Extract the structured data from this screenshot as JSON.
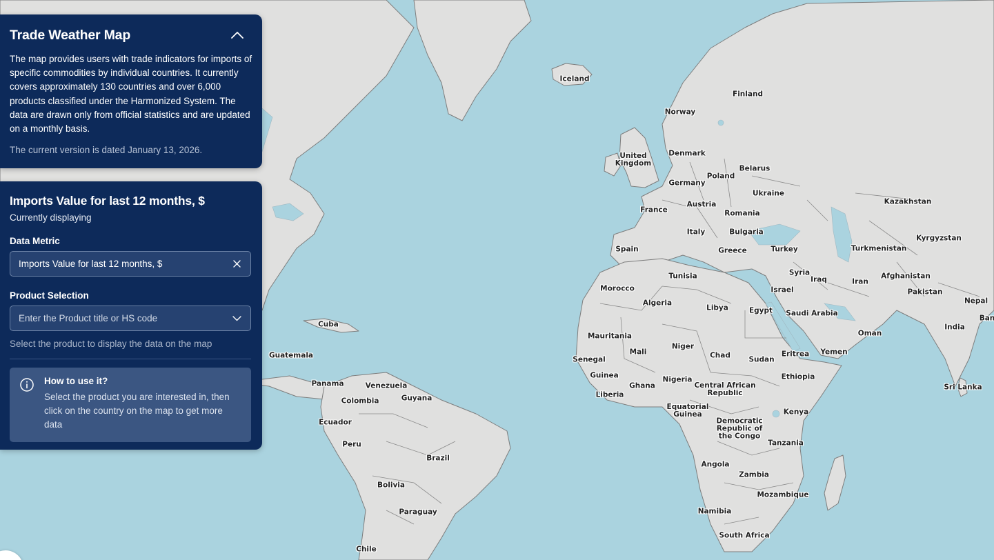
{
  "info_panel": {
    "title": "Trade Weather Map",
    "description": "The map provides users with trade indicators for imports of specific commodities by individual countries. It currently covers approximately 130 countries and over 6,000 products classified under the Harmonized System. The data are drawn only from official statistics and are updated on a monthly basis.",
    "version_text": "The current version is dated January 13, 2026.",
    "collapse_icon": "chevron-up-icon"
  },
  "controls_panel": {
    "title": "Imports Value for last 12 months, $",
    "subtitle": "Currently displaying",
    "metric_label": "Data Metric",
    "metric_value": "Imports Value for last 12 months, $",
    "product_label": "Product Selection",
    "product_placeholder": "Enter the Product title or HS code",
    "product_hint": "Select the product to display the data on the map",
    "howto_title": "How to use it?",
    "howto_body": "Select the product you are interested in, then click on the country on the map to get more data"
  },
  "map": {
    "colors": {
      "water": "#aad3df",
      "land": "#e0e0df",
      "panel": "#0d2a5a"
    },
    "countries": [
      [
        "Iceland"
      ],
      [
        "Finland"
      ],
      [
        "Norway"
      ],
      [
        "Denmark"
      ],
      [
        "United",
        "Kingdom"
      ],
      [
        "Belarus"
      ],
      [
        "Poland"
      ],
      [
        "Germany"
      ],
      [
        "Ukraine"
      ],
      [
        "Austria"
      ],
      [
        "France"
      ],
      [
        "Romania"
      ],
      [
        "Kazakhstan"
      ],
      [
        "Italy"
      ],
      [
        "Bulgaria"
      ],
      [
        "Kyrgyzstan"
      ],
      [
        "Spain"
      ],
      [
        "Turkey"
      ],
      [
        "Greece"
      ],
      [
        "Turkmenistan"
      ],
      [
        "Tunisia"
      ],
      [
        "Syria"
      ],
      [
        "Iraq"
      ],
      [
        "Afghanistan"
      ],
      [
        "Morocco"
      ],
      [
        "Israel"
      ],
      [
        "Iran"
      ],
      [
        "Pakistan"
      ],
      [
        "Nepal"
      ],
      [
        "Algeria"
      ],
      [
        "Libya"
      ],
      [
        "Egypt"
      ],
      [
        "Saudi Arabia"
      ],
      [
        "Ban"
      ],
      [
        "India"
      ],
      [
        "Cuba"
      ],
      [
        "Oman"
      ],
      [
        "Mauritania"
      ],
      [
        "Niger"
      ],
      [
        "Mali"
      ],
      [
        "Eritrea"
      ],
      [
        "Yemen"
      ],
      [
        "Chad"
      ],
      [
        "Guatemala"
      ],
      [
        "Senegal"
      ],
      [
        "Sudan"
      ],
      [
        "Guinea"
      ],
      [
        "Ethiopia"
      ],
      [
        "Nigeria"
      ],
      [
        "Panama"
      ],
      [
        "Venezuela"
      ],
      [
        "Central African",
        "Republic"
      ],
      [
        "Ghana"
      ],
      [
        "Sri Lanka"
      ],
      [
        "Liberia"
      ],
      [
        "Guyana"
      ],
      [
        "Colombia"
      ],
      [
        "Equatorial",
        "Guinea"
      ],
      [
        "Kenya"
      ],
      [
        "Ecuador"
      ],
      [
        "Democratic",
        "Republic of",
        "the Congo"
      ],
      [
        "Tanzania"
      ],
      [
        "Peru"
      ],
      [
        "Brazil"
      ],
      [
        "Angola"
      ],
      [
        "Zambia"
      ],
      [
        "Bolivia"
      ],
      [
        "Mozambique"
      ],
      [
        "Namibia"
      ],
      [
        "Paraguay"
      ],
      [
        "South Africa"
      ],
      [
        "Chile"
      ]
    ]
  }
}
